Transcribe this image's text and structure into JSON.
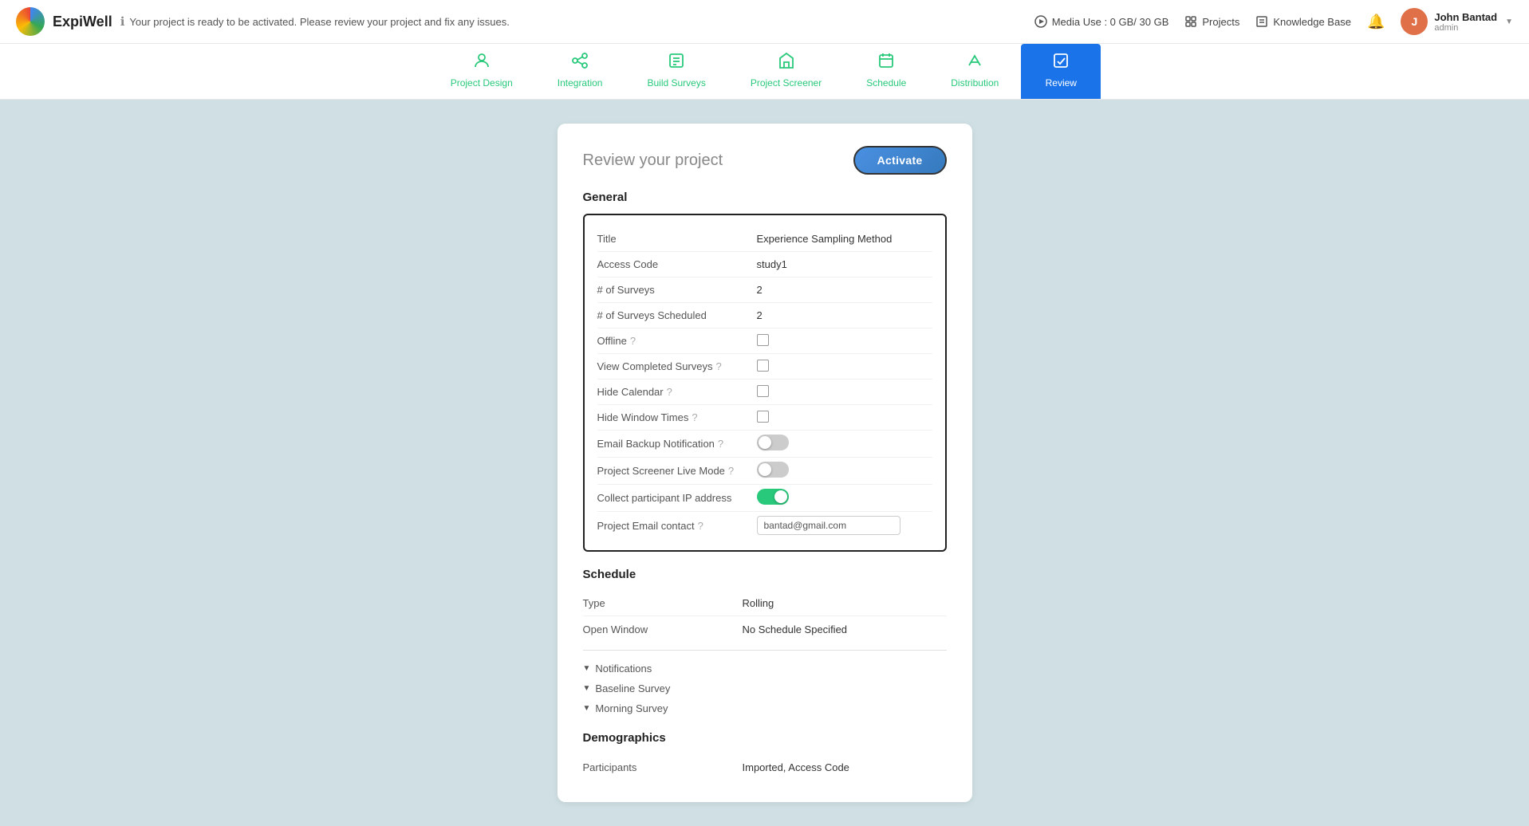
{
  "app": {
    "brand": "ExpiWell",
    "notice": "Your project is ready to be activated. Please review your project and fix any issues."
  },
  "topbar": {
    "media_use_label": "Media Use : 0 GB/ 30 GB",
    "projects_label": "Projects",
    "knowledge_base_label": "Knowledge Base",
    "user_name": "John Bantad",
    "user_role": "admin"
  },
  "nav": {
    "tabs": [
      {
        "id": "project-design",
        "label": "Project Design",
        "icon": "person-icon",
        "active": false
      },
      {
        "id": "integration",
        "label": "Integration",
        "icon": "integration-icon",
        "active": false
      },
      {
        "id": "build-surveys",
        "label": "Build Surveys",
        "icon": "surveys-icon",
        "active": false
      },
      {
        "id": "project-screener",
        "label": "Project Screener",
        "icon": "screener-icon",
        "active": false
      },
      {
        "id": "schedule",
        "label": "Schedule",
        "icon": "schedule-icon",
        "active": false
      },
      {
        "id": "distribution",
        "label": "Distribution",
        "icon": "distribution-icon",
        "active": false
      },
      {
        "id": "review",
        "label": "Review",
        "icon": "review-icon",
        "active": true
      }
    ]
  },
  "review": {
    "title": "Review your project",
    "activate_button": "Activate",
    "sections": {
      "general": {
        "title": "General",
        "fields": [
          {
            "label": "Title",
            "value": "Experience Sampling Method",
            "type": "text"
          },
          {
            "label": "Access Code",
            "value": "study1",
            "type": "text"
          },
          {
            "label": "# of Surveys",
            "value": "2",
            "type": "text"
          },
          {
            "label": "# of Surveys Scheduled",
            "value": "2",
            "type": "text"
          },
          {
            "label": "Offline",
            "value": "",
            "type": "checkbox",
            "has_help": true
          },
          {
            "label": "View Completed Surveys",
            "value": "",
            "type": "checkbox",
            "has_help": true
          },
          {
            "label": "Hide Calendar",
            "value": "",
            "type": "checkbox",
            "has_help": true
          },
          {
            "label": "Hide Window Times",
            "value": "",
            "type": "checkbox",
            "has_help": true
          },
          {
            "label": "Email Backup Notification",
            "value": "",
            "type": "toggle_off",
            "has_help": true
          },
          {
            "label": "Project Screener Live Mode",
            "value": "",
            "type": "toggle_off",
            "has_help": true
          },
          {
            "label": "Collect participant IP address",
            "value": "",
            "type": "toggle_on"
          },
          {
            "label": "Project Email contact",
            "value": "bantad@gmail.com",
            "type": "email",
            "has_help": true
          }
        ]
      },
      "schedule": {
        "title": "Schedule",
        "fields": [
          {
            "label": "Type",
            "value": "Rolling",
            "type": "text"
          },
          {
            "label": "Open Window",
            "value": "No Schedule Specified",
            "type": "text"
          }
        ],
        "collapsibles": [
          {
            "label": "Notifications"
          },
          {
            "label": "Baseline Survey"
          },
          {
            "label": "Morning Survey"
          }
        ]
      },
      "demographics": {
        "title": "Demographics",
        "fields": [
          {
            "label": "Participants",
            "value": "Imported, Access Code",
            "type": "text"
          }
        ]
      }
    }
  }
}
